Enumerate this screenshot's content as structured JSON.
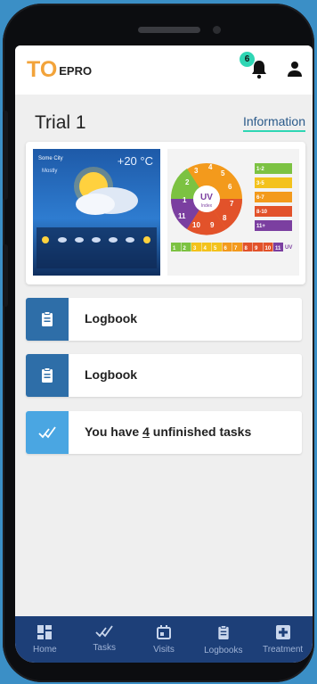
{
  "app": {
    "logo_mark": "TO",
    "logo_text": "EPRO",
    "notification_count": "6"
  },
  "page": {
    "title": "Trial 1",
    "info_link": "Information"
  },
  "weather_image": {
    "city": "Some City",
    "temp": "+20 °C",
    "condition": "Mostly"
  },
  "uv_image": {
    "center": "UV",
    "center_sub": "Index",
    "dial_numbers": [
      "1",
      "2",
      "3",
      "4",
      "5",
      "6",
      "7",
      "8",
      "9",
      "10",
      "11"
    ],
    "legend": [
      "1-2",
      "3-5",
      "6-7",
      "8-10",
      "11+"
    ],
    "scale": [
      "1",
      "2",
      "3",
      "4",
      "5",
      "6",
      "7",
      "8",
      "9",
      "10",
      "11"
    ],
    "scale_end": "UV"
  },
  "list": [
    {
      "label": "Logbook",
      "icon": "clipboard-icon"
    },
    {
      "label": "Logbook",
      "icon": "clipboard-icon"
    },
    {
      "label_prefix": "You have ",
      "count": "4",
      "label_suffix": " unfinished tasks",
      "icon": "double-check-icon"
    }
  ],
  "nav": [
    {
      "label": "Home",
      "icon": "home-grid-icon"
    },
    {
      "label": "Tasks",
      "icon": "double-check-icon"
    },
    {
      "label": "Visits",
      "icon": "calendar-icon"
    },
    {
      "label": "Logbooks",
      "icon": "clipboard-icon"
    },
    {
      "label": "Treatment",
      "icon": "medical-cross-icon"
    }
  ],
  "colors": {
    "accent": "#2fd6b4",
    "nav_bg": "#1d3f78",
    "icon_blue": "#2e6ea8",
    "logo_orange": "#f2a33a"
  }
}
